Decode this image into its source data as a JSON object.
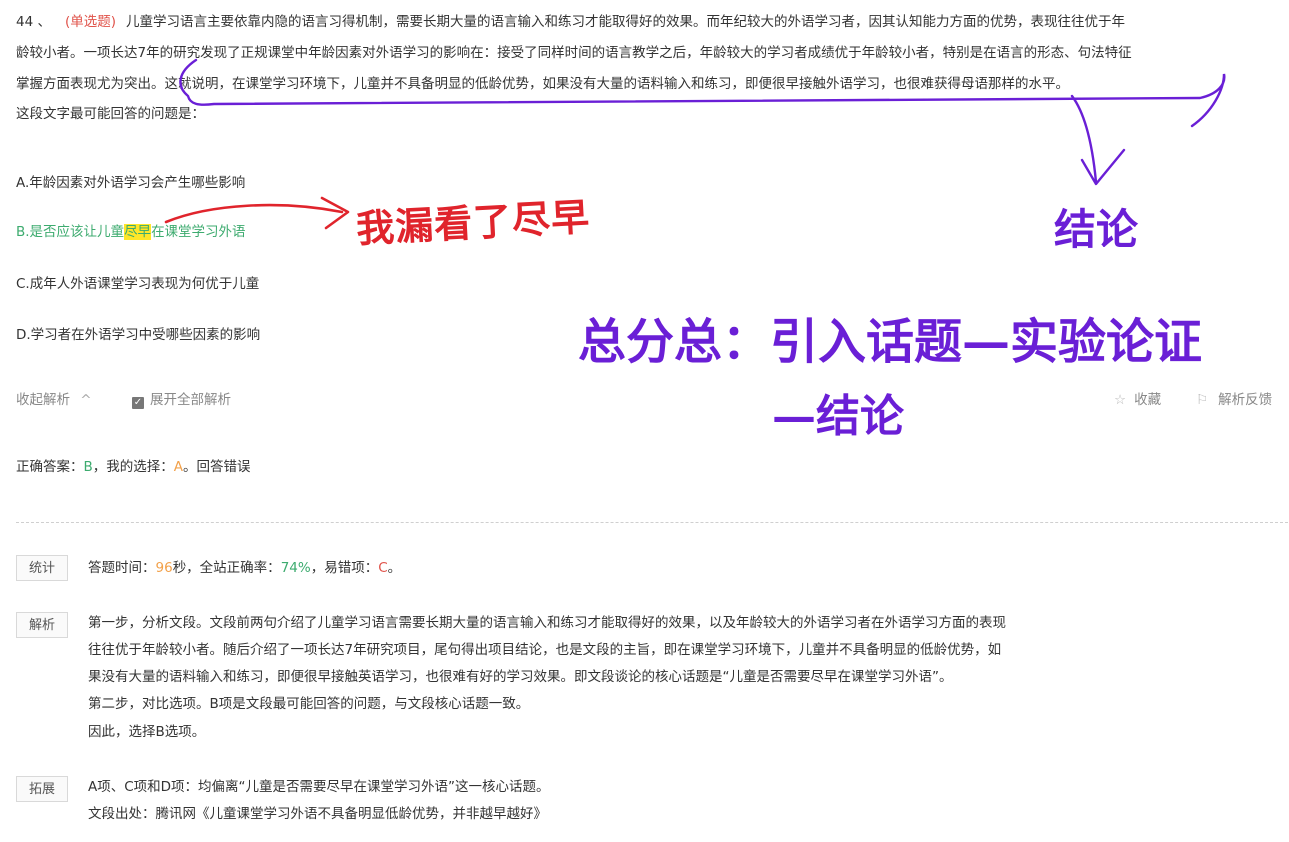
{
  "question": {
    "number": "44 、",
    "type": "(单选题)",
    "stem_lines": [
      "儿童学习语言主要依靠内隐的语言习得机制，需要长期大量的语言输入和练习才能取得好的效果。而年纪较大的外语学习者，因其认知能力方面的优势，表现往往优于年",
      "龄较小者。一项长达7年的研究发现了正规课堂中年龄因素对外语学习的影响在：接受了同样时间的语言教学之后，年龄较大的学习者成绩优于年龄较小者，特别是在语言的形态、句法特征",
      "掌握方面表现尤为突出。这就说明，在课堂学习环境下，儿童并不具备明显的低龄优势，如果没有大量的语料输入和练习，即便很早接触外语学习，也很难获得母语那样的水平。"
    ],
    "prompt": "这段文字最可能回答的问题是："
  },
  "options": [
    {
      "label": "A.年龄因素对外语学习会产生哪些影响"
    },
    {
      "label_pre": "B.是否应该让儿童",
      "label_hl": "尽早",
      "label_post": "在课堂学习外语"
    },
    {
      "label": "C.成年人外语课堂学习表现为何优于儿童"
    },
    {
      "label": "D.学习者在外语学习中受哪些因素的影响"
    }
  ],
  "toolbar": {
    "collapse_label": "收起解析",
    "collapse_icon": "^",
    "expand_all_label": "展开全部解析",
    "favorite_label": "收藏",
    "feedback_label": "解析反馈"
  },
  "answer": {
    "prefix": "正确答案：",
    "correct": "B",
    "mid": "，我的选择：",
    "mine": "A",
    "result": "。回答错误"
  },
  "stats": {
    "tag": "统计",
    "time_prefix": "答题时间：",
    "time_value": "96",
    "time_unit": "秒，全站正确率：",
    "rate_value": "74%",
    "wrong_prefix": "，易错项：",
    "wrong_value": "C",
    "end": "。"
  },
  "analysis": {
    "tag": "解析",
    "lines": [
      "第一步，分析文段。文段前两句介绍了儿童学习语言需要长期大量的语言输入和练习才能取得好的效果，以及年龄较大的外语学习者在外语学习方面的表现",
      "往往优于年龄较小者。随后介绍了一项长达7年研究项目，尾句得出项目结论，也是文段的主旨，即在课堂学习环境下，儿童并不具备明显的低龄优势，如",
      "果没有大量的语料输入和练习，即便很早接触英语学习，也很难有好的学习效果。即文段谈论的核心话题是“儿童是否需要尽早在课堂学习外语”。",
      "第二步，对比选项。B项是文段最可能回答的问题，与文段核心话题一致。",
      "因此，选择B选项。"
    ]
  },
  "extension": {
    "tag": "拓展",
    "lines": [
      "A项、C项和D项：均偏离“儿童是否需要尽早在课堂学习外语”这一核心话题。",
      "文段出处：腾讯网《儿童课堂学习外语不具备明显低龄优势，并非越早越好》"
    ]
  },
  "annotations": {
    "red_note": "我漏看了尽早",
    "conclusion": "结论",
    "structure_line1": "总分总：引入话题—实验论证",
    "structure_line2": "—结论",
    "colors": {
      "red_ink": "#e0242c",
      "purple_ink": "#6a1fd6"
    }
  }
}
